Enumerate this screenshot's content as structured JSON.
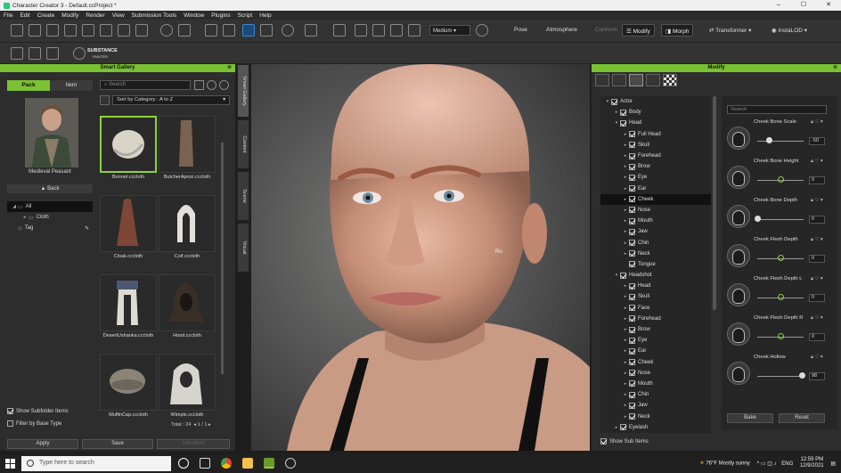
{
  "window": {
    "title": "Character Creator 3 - Default.ccProject *",
    "controls": [
      "–",
      "☐",
      "✕"
    ]
  },
  "menu": [
    "File",
    "Edit",
    "Create",
    "Modify",
    "Render",
    "View",
    "Submission Tools",
    "Window",
    "Plugins",
    "Script",
    "Help"
  ],
  "toolbar": {
    "quality": "Medium",
    "pose": "Pose",
    "atmosphere": "Atmosphere",
    "conform": "Conform",
    "modify": "Modify",
    "morph": "Morph",
    "transformer": "Transformer",
    "instalod": "InstaLOD",
    "substance": "SUBSTANCE",
    "substance_sub": "PAINTER"
  },
  "smart_gallery": {
    "title": "Smart Gallery",
    "tabs": [
      "Pack",
      "Item"
    ],
    "pack_name": "Medieval Peasant",
    "back": "Back",
    "tree": [
      {
        "label": "All",
        "selected": true
      },
      {
        "label": "Cloth",
        "selected": false
      },
      {
        "label": "Tag",
        "selected": false
      }
    ],
    "search_placeholder": "Search",
    "sort": "Sort by Category : A to Z",
    "items": [
      {
        "name": "Bonnet.cccloth",
        "selected": true
      },
      {
        "name": "ButcherApron.cccloth",
        "selected": false
      },
      {
        "name": "Cloak.cccloth",
        "selected": false
      },
      {
        "name": "Coif.cccloth",
        "selected": false
      },
      {
        "name": "DesertUshanka.cccloth",
        "selected": false
      },
      {
        "name": "Hood.cccloth",
        "selected": false
      },
      {
        "name": "MuffinCap.cccloth",
        "selected": false
      },
      {
        "name": "Wimple.cccloth",
        "selected": false
      }
    ],
    "total": "Total : 24",
    "pager": "1 / 1",
    "show_subfolder": "Show Subfolder Items",
    "filter_base": "Filter by Base Type",
    "apply": "Apply",
    "save": "Save",
    "uncollect": "Uncollect"
  },
  "side_tabs": [
    "Smart Gallery",
    "Content",
    "Scene",
    "Visual"
  ],
  "modify": {
    "title": "Modify",
    "tree": [
      {
        "label": "Actor",
        "level": 0,
        "arrow": "▾"
      },
      {
        "label": "Body",
        "level": 1,
        "arrow": "▸"
      },
      {
        "label": "Head",
        "level": 1,
        "arrow": "▾"
      },
      {
        "label": "Full Head",
        "level": 2,
        "arrow": "▸"
      },
      {
        "label": "Skull",
        "level": 2,
        "arrow": "▸"
      },
      {
        "label": "Forehead",
        "level": 2,
        "arrow": "▸"
      },
      {
        "label": "Brow",
        "level": 2,
        "arrow": "▸"
      },
      {
        "label": "Eye",
        "level": 2,
        "arrow": "▸"
      },
      {
        "label": "Ear",
        "level": 2,
        "arrow": "▸"
      },
      {
        "label": "Cheek",
        "level": 2,
        "arrow": "▸",
        "selected": true
      },
      {
        "label": "Nose",
        "level": 2,
        "arrow": "▸"
      },
      {
        "label": "Mouth",
        "level": 2,
        "arrow": "▸"
      },
      {
        "label": "Jaw",
        "level": 2,
        "arrow": "▸"
      },
      {
        "label": "Chin",
        "level": 2,
        "arrow": "▸"
      },
      {
        "label": "Neck",
        "level": 2,
        "arrow": "▸"
      },
      {
        "label": "Tongue",
        "level": 2,
        "arrow": ""
      },
      {
        "label": "Headshot",
        "level": 1,
        "arrow": "▾"
      },
      {
        "label": "Head",
        "level": 2,
        "arrow": "▸"
      },
      {
        "label": "Skull",
        "level": 2,
        "arrow": "▸"
      },
      {
        "label": "Face",
        "level": 2,
        "arrow": "▸"
      },
      {
        "label": "Forehead",
        "level": 2,
        "arrow": "▸"
      },
      {
        "label": "Brow",
        "level": 2,
        "arrow": "▸"
      },
      {
        "label": "Eye",
        "level": 2,
        "arrow": "▸"
      },
      {
        "label": "Ear",
        "level": 2,
        "arrow": "▸"
      },
      {
        "label": "Cheek",
        "level": 2,
        "arrow": "▸"
      },
      {
        "label": "Nose",
        "level": 2,
        "arrow": "▸"
      },
      {
        "label": "Mouth",
        "level": 2,
        "arrow": "▸"
      },
      {
        "label": "Chin",
        "level": 2,
        "arrow": "▸"
      },
      {
        "label": "Jaw",
        "level": 2,
        "arrow": "▸"
      },
      {
        "label": "Neck",
        "level": 2,
        "arrow": "▸"
      },
      {
        "label": "Eyelash",
        "level": 1,
        "arrow": "▸"
      }
    ],
    "search_placeholder": "Search",
    "sliders": [
      {
        "label": "Cheek Bone Scale",
        "value": "-50",
        "fraction": 0.25
      },
      {
        "label": "Cheek Bone Height",
        "value": "0",
        "fraction": 0.5
      },
      {
        "label": "Cheek Bone Depth",
        "value": "0",
        "fraction": 0.0
      },
      {
        "label": "Cheek Flesh Depth",
        "value": "0",
        "fraction": 0.5
      },
      {
        "label": "Cheek Flesh Depth L",
        "value": "0",
        "fraction": 0.5
      },
      {
        "label": "Cheek Flesh Depth R",
        "value": "0",
        "fraction": 0.5
      },
      {
        "label": "Cheek Hollow",
        "value": "98",
        "fraction": 0.98
      }
    ],
    "bake": "Bake",
    "reset": "Reset",
    "show_sub_items": "Show Sub Items"
  },
  "viewport": {
    "cursor_label": "Ro"
  },
  "taskbar": {
    "search_placeholder": "Type here to search",
    "weather": "76°F  Mostly sunny",
    "lang": "ENG",
    "time": "12:59 PM",
    "date": "12/9/2021"
  },
  "colors": {
    "accent": "#7ac231",
    "panel": "#2d2d2d",
    "taskbar": "#202020"
  }
}
